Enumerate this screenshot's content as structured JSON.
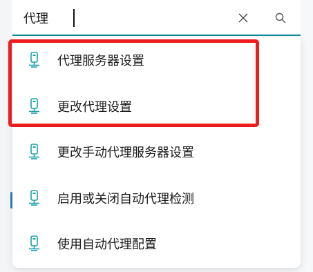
{
  "search": {
    "value": "代理",
    "clear_icon": "close-icon",
    "search_icon": "search-icon"
  },
  "results": [
    {
      "label": "代理服务器设置",
      "icon": "proxy-settings-icon"
    },
    {
      "label": "更改代理设置",
      "icon": "proxy-settings-icon"
    },
    {
      "label": "更改手动代理服务器设置",
      "icon": "proxy-settings-icon"
    },
    {
      "label": "启用或关闭自动代理检测",
      "icon": "proxy-settings-icon"
    },
    {
      "label": "使用自动代理配置",
      "icon": "proxy-settings-icon"
    }
  ],
  "colors": {
    "accent": "#0f8f99",
    "highlight": "#ee1c1c",
    "icon": "#1aa0a8"
  }
}
